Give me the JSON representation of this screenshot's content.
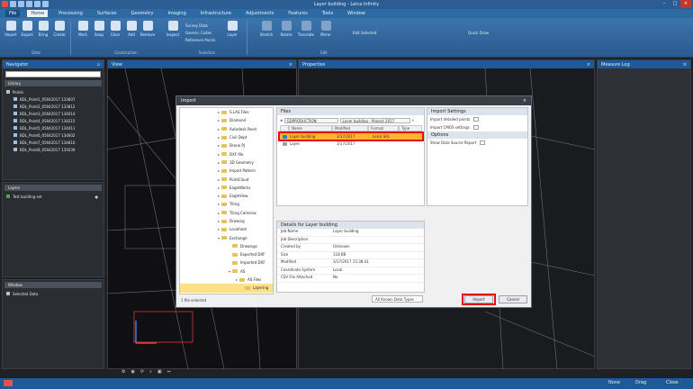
{
  "window": {
    "title": "Layer building - Leica Infinity"
  },
  "ribbon": {
    "tabs": [
      "File",
      "Home",
      "Processing",
      "Surfaces",
      "Geometry",
      "Imaging",
      "Infrastructure",
      "Adjustments",
      "Features",
      "Tools",
      "Window"
    ],
    "buttons": [
      "Import",
      "Export",
      "Bring",
      "Create",
      "Mark",
      "Snap",
      "Clear",
      "Add",
      "Remove",
      "Inspect",
      "Layer",
      "Stretch",
      "Rotate",
      "Translate",
      "Mirror"
    ],
    "small_items": [
      "Survey Data",
      "Generic Codes",
      "Reference Points",
      "Edit Selected",
      "Quick Draw"
    ],
    "groups": [
      "Data",
      "Construction",
      "Selection",
      "Edit"
    ]
  },
  "left_panels": {
    "navigator": {
      "title": "Navigator",
      "section": "Library",
      "root": "Points",
      "items": [
        "BDL_Point1_05042017 133607",
        "BDL_Point2_05042017 133812",
        "BDL_Point3_05042017 134014",
        "BDL_Point4_05042017 134215",
        "BDL_Point5_05042017 134411",
        "BDL_Point6_05042017 134602",
        "BDL_Point7_05042017 134810",
        "BDL_Point8_05042017 135039"
      ]
    },
    "layers": {
      "title": "Layers",
      "item": "Test building set"
    },
    "window": {
      "title": "Window",
      "item": "Selected Data"
    }
  },
  "views": {
    "view_title": "View",
    "properties_title": "Properties",
    "measure_title": "Measure Log"
  },
  "dialog": {
    "title": "Import",
    "folders": [
      "S.LAS.Files",
      "Diamond",
      "Autodesk Revit",
      "Civil Dept",
      "Drone PJ",
      "DXF file",
      "3D Geometry",
      "Import Pattern",
      "PointCloud",
      "EagleWorks",
      "EagleView",
      "Tiling",
      "Tiling Cameras",
      "Drawing",
      "Localhost",
      "Exchange",
      "Drawings",
      "Exported DXF",
      "Imported DXF",
      "AS",
      "AS Files",
      "Layering"
    ],
    "files_title": "Files",
    "path": "GDPRODUCTION",
    "search": "Layer building - Project 2017",
    "columns": [
      "Name",
      "Modified",
      "Format",
      "Type"
    ],
    "file_rows": [
      {
        "name": "Layer building",
        "modified": "3/17/2017",
        "format": "Leica SPL",
        "selected": true
      },
      {
        "name": "Layer",
        "modified": "3/17/2017",
        "format": "",
        "selected": false
      }
    ],
    "settings_title": "Import Settings",
    "settings": [
      "Import detailed points",
      "Import CMOS settings"
    ],
    "settings_sub": "Options",
    "option": "Show Data Source Report",
    "details_title": "Details for Layer building",
    "details": [
      [
        "Job Name",
        "Layer building"
      ],
      [
        "Job Description",
        ""
      ],
      [
        "Created by",
        "Unknown"
      ],
      [
        "Size",
        "118 KB"
      ],
      [
        "Modified",
        "3/17/2017 15:38:41"
      ],
      [
        "Coordinate System",
        "Local"
      ],
      [
        "CSV File Attached",
        "No"
      ]
    ],
    "selected_count": "1 file selected",
    "file_type": "All Known Data Types",
    "import_label": "Import",
    "cancel_label": "Cancel"
  },
  "status": {
    "items": [
      "None",
      "Drag",
      "Close"
    ]
  },
  "colors": {
    "accent": "#1e5a97",
    "highlight": "#e01010",
    "selection": "#ffe08a"
  }
}
